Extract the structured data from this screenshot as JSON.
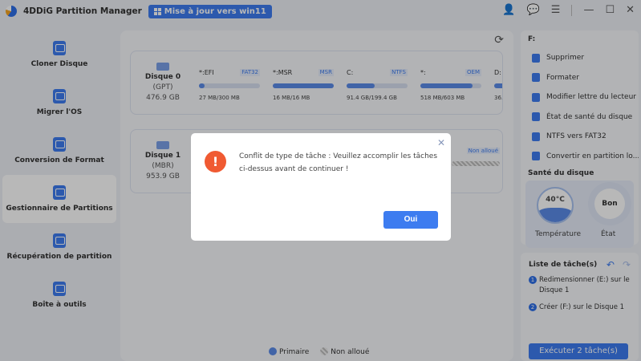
{
  "app": {
    "title": "4DDiG Partition Manager",
    "upgrade": "Mise à jour vers win11"
  },
  "titlebar": {
    "icons": [
      "user-icon",
      "feedback-icon",
      "menu-icon",
      "minimize-icon",
      "maximize-icon",
      "close-icon"
    ]
  },
  "sidebar": {
    "items": [
      {
        "label": "Cloner Disque"
      },
      {
        "label": "Migrer l'OS"
      },
      {
        "label": "Conversion de Format"
      },
      {
        "label": "Gestionnaire de Partitions",
        "active": true
      },
      {
        "label": "Récupération de partition"
      },
      {
        "label": "Boîte à outils"
      }
    ]
  },
  "disks": [
    {
      "name": "Disque 0",
      "type": "(GPT)",
      "size": "476.9 GB",
      "partitions": [
        {
          "label": "*:EFI",
          "fs": "FAT32",
          "usage": "27 MB/300 MB",
          "fill": 9
        },
        {
          "label": "*:MSR",
          "fs": "MSR",
          "usage": "16 MB/16 MB",
          "fill": 100
        },
        {
          "label": "C:",
          "fs": "NTFS",
          "usage": "91.4 GB/199.4 GB",
          "fill": 46
        },
        {
          "label": "*:",
          "fs": "OEM",
          "usage": "518 MB/603 MB",
          "fill": 86
        },
        {
          "label": "D:",
          "fs": "",
          "usage": "36.",
          "fill": 50
        }
      ]
    },
    {
      "name": "Disque 1",
      "type": "(MBR)",
      "size": "953.9 GB",
      "unalloc": "Non alloué"
    }
  ],
  "legend": {
    "primary": "Primaire",
    "unallocated": "Non alloué"
  },
  "right": {
    "drive": "F:",
    "menu": [
      "Supprimer",
      "Formater",
      "Modifier lettre du lecteur",
      "État de santé du disque",
      "NTFS vers FAT32",
      "Convertir en partition lo..."
    ],
    "health_title": "Santé du disque",
    "temp": "40°C",
    "temp_label": "Température",
    "state": "Bon",
    "state_label": "État"
  },
  "tasks": {
    "title": "Liste de tâche(s)",
    "items": [
      {
        "n": "1",
        "text": "Redimensionner (E:) sur le Disque 1"
      },
      {
        "n": "2",
        "text": "Créer (F:) sur le Disque 1"
      }
    ],
    "execute": "Exécuter 2 tâche(s)"
  },
  "dialog": {
    "message": "Conflit de type de tâche : Veuillez accomplir les tâches ci-dessus avant de continuer !",
    "ok": "Oui"
  }
}
